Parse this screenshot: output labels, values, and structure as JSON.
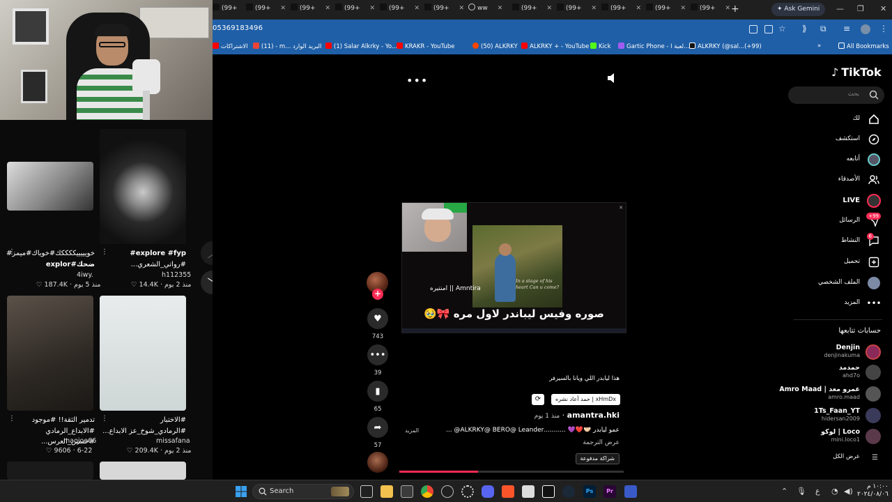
{
  "browser": {
    "tabs": [
      {
        "label": "(99+",
        "icon": "tiktok-icon"
      },
      {
        "label": "(99+",
        "icon": "tiktok-icon"
      },
      {
        "label": "(99+",
        "icon": "tiktok-icon"
      },
      {
        "label": "(99+",
        "icon": "tiktok-icon"
      },
      {
        "label": "(99+",
        "icon": "tiktok-icon"
      },
      {
        "label": "(99+",
        "icon": "tiktok-icon"
      },
      {
        "label": "ww",
        "icon": "globe-icon"
      },
      {
        "label": "(99+",
        "icon": "tiktok-icon"
      },
      {
        "label": "(99+",
        "icon": "tiktok-icon"
      },
      {
        "label": "(99+",
        "icon": "tiktok-icon"
      },
      {
        "label": "(99+",
        "icon": "tiktok-icon"
      },
      {
        "label": "(99+",
        "icon": "tiktok-icon"
      }
    ],
    "gemini_label": "Ask Gemini",
    "url": "05369183496",
    "bookmarks": [
      {
        "label": "الاشتراكات",
        "color": "#ff0000"
      },
      {
        "label": "(11) - m... البريد الوارد",
        "color": "#ea4335"
      },
      {
        "label": "(1) Salar Alkrky - Yo...",
        "color": "#ff0000"
      },
      {
        "label": "KRAKR - YouTube",
        "color": "#ff0000"
      },
      {
        "label": "(50) ALKRKY",
        "color": "#ff4500"
      },
      {
        "label": "ALKRKY + - YouTube",
        "color": "#ff0000"
      },
      {
        "label": "Kick",
        "color": "#53fc18"
      },
      {
        "label": "Gartic Phone - لعبة ا...",
        "color": "#a05cf0"
      },
      {
        "label": "ALKRKY (@sal...(+99)",
        "color": "#111111"
      }
    ],
    "all_bookmarks": "All Bookmarks"
  },
  "left_feed": {
    "items": [
      {
        "caption1": "خويييييككككك#خوياك#ميمز#",
        "caption2": "ضحك#explor",
        "author": "4iwy.",
        "views": "187.4K",
        "ago": "منذ 5 يوم"
      },
      {
        "caption1": "explore #fyp#",
        "caption2": "#رواتي_الشعري...",
        "author": "h112355",
        "views": "14.4K",
        "ago": "منذ 2 يوم"
      },
      {
        "caption1": "تدمير الثقة!! #موجود",
        "caption2": "#الابداع_الرمادي #حسين_العرس...",
        "author": "maojoo66",
        "views": "9606",
        "ago": "6-22"
      },
      {
        "caption1": "#الاختبار",
        "caption2": "#الرمادي_شوخ_عز الابداع...",
        "author": "missafana",
        "views": "209.4K",
        "ago": "منذ 2 يوم"
      }
    ]
  },
  "video": {
    "overlay_label": "امنتيره || Amntira",
    "caption": "صوره وفيس ليباندر لاول مره 🎀🥹",
    "photo_quote": "In a stage of his heart Can u come?"
  },
  "actions": {
    "likes": "743",
    "comments": "39",
    "saves": "65",
    "shares": "57"
  },
  "post": {
    "description": "هذا ليابدر اللي ويانا بالسيرفر",
    "repost_chip": "xHmDx | حمد أعاد نشره",
    "author": "amantra.hki",
    "ago": "منذ 1 يوم",
    "caption": "عمو ليابدر 🤝🏻❤️💜 ...........ALKRKY@ BERO@ Leander@ ...",
    "more": "المزيد",
    "translate": "عرض الترجمة",
    "paid_chip": "شراكة مدفوعة"
  },
  "tiktok_sidebar": {
    "logo": "TikTok",
    "search_placeholder": "بحث",
    "nav": [
      {
        "label": "لك",
        "icon": "home-icon"
      },
      {
        "label": "استكشف",
        "icon": "compass-icon"
      },
      {
        "label": "أتابعه",
        "icon": "following-icon"
      },
      {
        "label": "الأصدقاء",
        "icon": "friends-icon"
      },
      {
        "label": "LIVE",
        "icon": "live-icon"
      },
      {
        "label": "الرسائل",
        "icon": "messages-icon",
        "badge": "+99"
      },
      {
        "label": "النشاط",
        "icon": "activity-icon",
        "badge": "6"
      },
      {
        "label": "تحميل",
        "icon": "upload-icon"
      },
      {
        "label": "الملف الشخصي",
        "icon": "profile-icon"
      },
      {
        "label": "المزيد",
        "icon": "more-icon"
      }
    ],
    "following_title": "حسابات تتابعها",
    "accounts": [
      {
        "name": "Denjin",
        "handle": "denjinakuma",
        "color": "#8a2a5a"
      },
      {
        "name": "حمدمد",
        "handle": "ahd7o",
        "color": "#444444"
      },
      {
        "name": "Amro Maad | عمرو معد",
        "handle": "amro.maad",
        "color": "#555555"
      },
      {
        "name": "1Ts_Faan_YT",
        "handle": "hidersan2009",
        "color": "#3a3a5a"
      },
      {
        "name": "لوكو | Loco",
        "handle": "mini.loco1",
        "color": "#5a3a4a"
      }
    ],
    "see_all": "عرض الكل"
  },
  "taskbar": {
    "search_label": "Search",
    "time": "١٠:٠٠ م",
    "date": "٢٠٢٤/٠٨/٠٦"
  }
}
